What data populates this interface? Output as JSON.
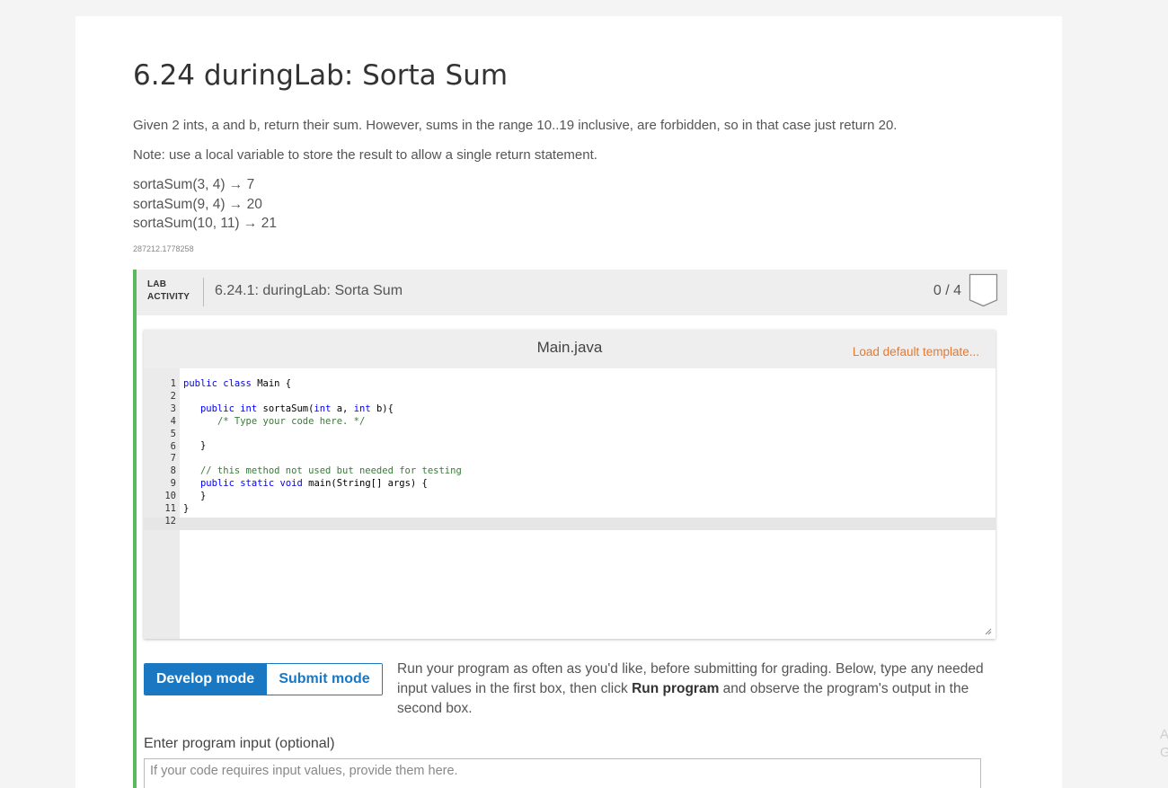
{
  "section": {
    "title": "6.24 duringLab: Sorta Sum",
    "description": "Given 2 ints, a and b, return their sum. However, sums in the range 10..19 inclusive, are forbidden, so in that case just return 20.",
    "note": "Note: use a local variable to store the result to allow a single return statement.",
    "examples": [
      "sortaSum(3, 4) → 7",
      "sortaSum(9, 4) → 20",
      "sortaSum(10, 11) → 21"
    ],
    "resource_id": "287212.1778258"
  },
  "lab": {
    "tag_line1": "LAB",
    "tag_line2": "ACTIVITY",
    "title": "6.24.1: duringLab: Sorta Sum",
    "score": "0 / 4",
    "accent_color": "#5cb85c"
  },
  "editor": {
    "file_name": "Main.java",
    "load_default_label": "Load default template...",
    "line_numbers": [
      "1",
      "2",
      "3",
      "4",
      "5",
      "6",
      "7",
      "8",
      "9",
      "10",
      "11",
      "12"
    ],
    "code_lines": [
      "public class Main {",
      "",
      "   public int sortaSum(int a, int b){",
      "      /* Type your code here. */",
      "",
      "   }",
      "",
      "   // this method not used but needed for testing",
      "   public static void main(String[] args) {",
      "   }",
      "}",
      ""
    ]
  },
  "modes": {
    "develop_label": "Develop mode",
    "submit_label": "Submit mode",
    "description_before": "Run your program as often as you'd like, before submitting for grading. Below, type any needed input values in the first box, then click ",
    "description_bold": "Run program",
    "description_after": " and observe the program's output in the second box.",
    "active_color": "#1a78c2"
  },
  "input": {
    "label": "Enter program input (optional)",
    "placeholder": "If your code requires input values, provide them here."
  },
  "edge": {
    "line1": "A",
    "line2": "G"
  }
}
